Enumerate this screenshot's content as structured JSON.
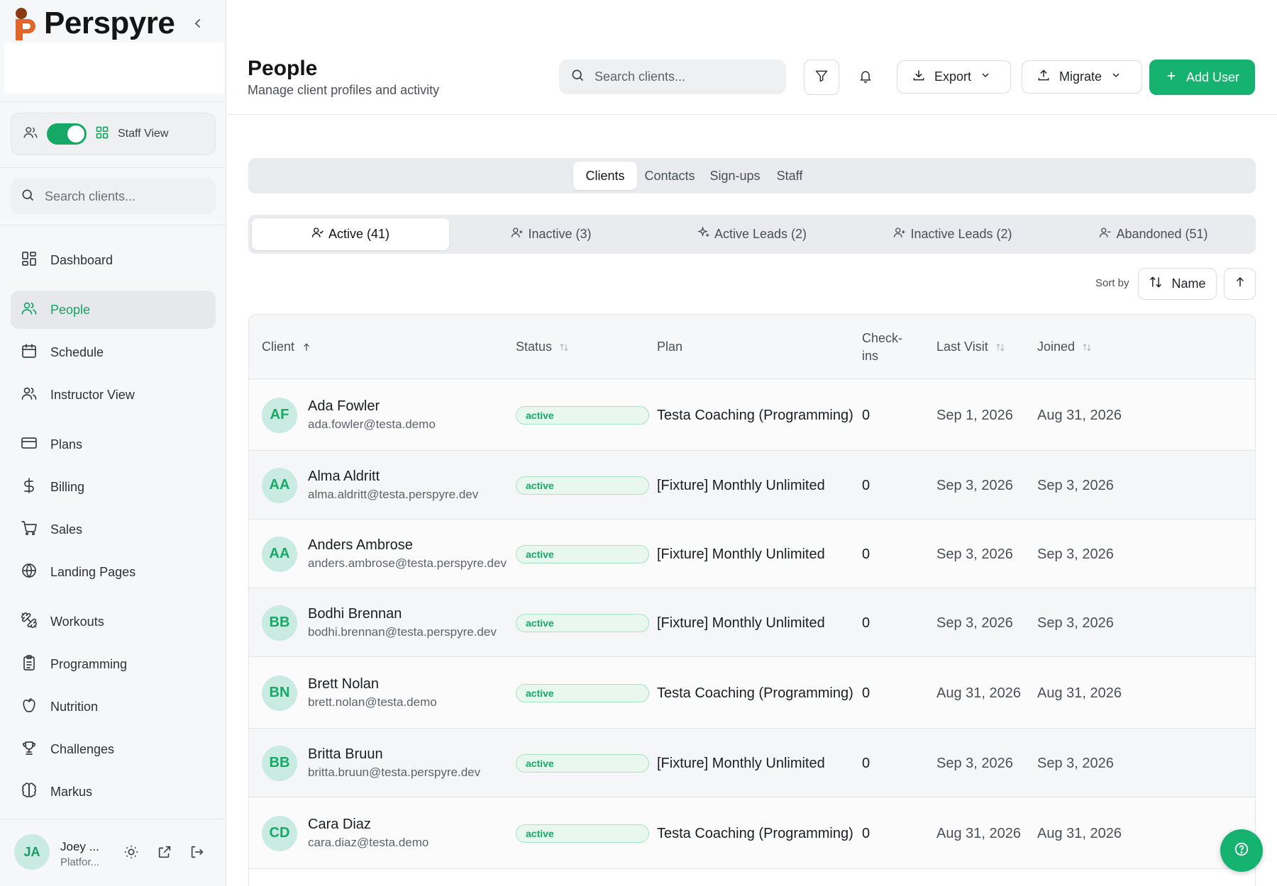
{
  "brand": {
    "name": "Perspyre"
  },
  "sidebar": {
    "toggle_label": "Staff View",
    "search_placeholder": "Search clients...",
    "nav": [
      {
        "label": "Dashboard",
        "icon": "dashboard-icon"
      },
      {
        "label": "People",
        "icon": "people-icon",
        "active": true
      },
      {
        "label": "Schedule",
        "icon": "calendar-icon"
      },
      {
        "label": "Instructor View",
        "icon": "instructor-icon"
      },
      {
        "label": "Plans",
        "icon": "card-icon"
      },
      {
        "label": "Billing",
        "icon": "dollar-icon"
      },
      {
        "label": "Sales",
        "icon": "cart-icon"
      },
      {
        "label": "Landing Pages",
        "icon": "globe-icon"
      },
      {
        "label": "Workouts",
        "icon": "dumbbell-icon"
      },
      {
        "label": "Programming",
        "icon": "clipboard-icon"
      },
      {
        "label": "Nutrition",
        "icon": "apple-icon"
      },
      {
        "label": "Challenges",
        "icon": "trophy-icon"
      },
      {
        "label": "Markus",
        "icon": "brain-icon"
      }
    ],
    "user": {
      "initials": "JA",
      "name": "Joey ...",
      "role": "Platfor..."
    }
  },
  "header": {
    "title": "People",
    "subtitle": "Manage client profiles and activity",
    "search_placeholder": "Search clients...",
    "export_label": "Export",
    "migrate_label": "Migrate",
    "add_label": "Add User"
  },
  "tabs": [
    {
      "label": "Clients",
      "active": true
    },
    {
      "label": "Contacts"
    },
    {
      "label": "Sign-ups"
    },
    {
      "label": "Staff"
    }
  ],
  "status_tabs": [
    {
      "label": "Active (41)",
      "active": true
    },
    {
      "label": "Inactive (3)"
    },
    {
      "label": "Active Leads (2)"
    },
    {
      "label": "Inactive Leads (2)"
    },
    {
      "label": "Abandoned (51)"
    }
  ],
  "sort": {
    "label": "Sort by",
    "field": "Name"
  },
  "table": {
    "columns": [
      "Client",
      "Status",
      "Plan",
      "Check-ins",
      "Last Visit",
      "Joined"
    ],
    "rows": [
      {
        "initials": "AF",
        "name": "Ada Fowler",
        "email": "ada.fowler@testa.demo",
        "status": "active",
        "plan": "Testa Coaching (Programming)",
        "checkins": "0",
        "last_visit": "Sep 1, 2026",
        "joined": "Aug 31, 2026"
      },
      {
        "initials": "AA",
        "name": "Alma Aldritt",
        "email": "alma.aldritt@testa.perspyre.dev",
        "status": "active",
        "plan": "[Fixture] Monthly Unlimited",
        "checkins": "0",
        "last_visit": "Sep 3, 2026",
        "joined": "Sep 3, 2026"
      },
      {
        "initials": "AA",
        "name": "Anders Ambrose",
        "email": "anders.ambrose@testa.perspyre.dev",
        "status": "active",
        "plan": "[Fixture] Monthly Unlimited",
        "checkins": "0",
        "last_visit": "Sep 3, 2026",
        "joined": "Sep 3, 2026"
      },
      {
        "initials": "BB",
        "name": "Bodhi Brennan",
        "email": "bodhi.brennan@testa.perspyre.dev",
        "status": "active",
        "plan": "[Fixture] Monthly Unlimited",
        "checkins": "0",
        "last_visit": "Sep 3, 2026",
        "joined": "Sep 3, 2026"
      },
      {
        "initials": "BN",
        "name": "Brett Nolan",
        "email": "brett.nolan@testa.demo",
        "status": "active",
        "plan": "Testa Coaching (Programming)",
        "checkins": "0",
        "last_visit": "Aug 31, 2026",
        "joined": "Aug 31, 2026"
      },
      {
        "initials": "BB",
        "name": "Britta Bruun",
        "email": "britta.bruun@testa.perspyre.dev",
        "status": "active",
        "plan": "[Fixture] Monthly Unlimited",
        "checkins": "0",
        "last_visit": "Sep 3, 2026",
        "joined": "Sep 3, 2026"
      },
      {
        "initials": "CD",
        "name": "Cara Diaz",
        "email": "cara.diaz@testa.demo",
        "status": "active",
        "plan": "Testa Coaching (Programming)",
        "checkins": "0",
        "last_visit": "Aug 31, 2026",
        "joined": "Aug 31, 2026"
      }
    ]
  },
  "colors": {
    "accent": "#16b370",
    "accent_text": "#14a463",
    "avatar_bg": "#c9ebe1"
  }
}
